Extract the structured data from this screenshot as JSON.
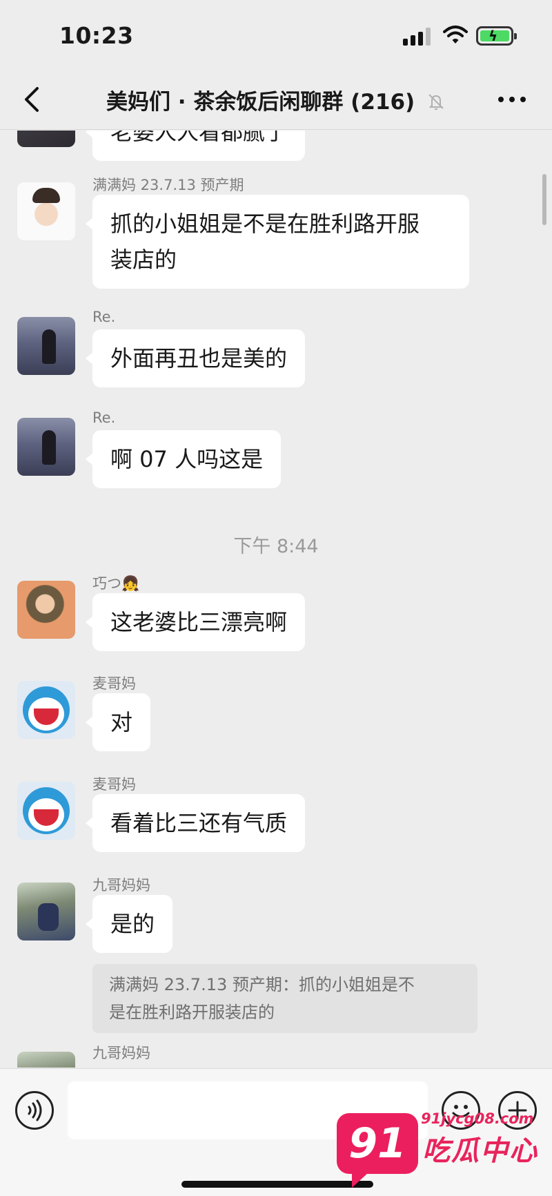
{
  "status_bar": {
    "time": "10:23"
  },
  "nav": {
    "title": "美妈们 · 茶余饭后闲聊群 (216)"
  },
  "messages": [
    {
      "text": "老婆人人看都腻了"
    },
    {
      "sender": "满满妈 23.7.13 预产期",
      "text_line1": "抓的小姐姐是不是在胜利路开服",
      "text_line2": "装店的"
    },
    {
      "sender": "Re.",
      "text": "外面再丑也是美的"
    },
    {
      "sender": "Re.",
      "text": "啊 07 人吗这是"
    },
    {
      "timestamp": "下午 8:44"
    },
    {
      "sender": "巧つ",
      "sender_emoji": "👧",
      "text": "这老婆比三漂亮啊"
    },
    {
      "sender": "麦哥妈",
      "text": "对"
    },
    {
      "sender": "麦哥妈",
      "text": "看着比三还有气质"
    },
    {
      "sender": "九哥妈妈",
      "text": "是的",
      "quote_line1": "满满妈 23.7.13 预产期：抓的小姐姐是不",
      "quote_line2": "是在胜利路开服装店的"
    },
    {
      "sender": "九哥妈妈"
    }
  ],
  "input_bar": {
    "value": ""
  },
  "watermark": {
    "url": "91jycg08.com",
    "badge": "91",
    "name": "吃瓜中心"
  },
  "colors": {
    "background": "#ededed",
    "bubble": "#ffffff",
    "accent": "#ec1f5e",
    "meta_text": "#7d7d7d"
  },
  "icons": [
    "back-icon",
    "mute-icon",
    "more-icon",
    "voice-icon",
    "emoji-icon",
    "plus-icon",
    "signal-icon",
    "wifi-icon",
    "battery-icon"
  ]
}
